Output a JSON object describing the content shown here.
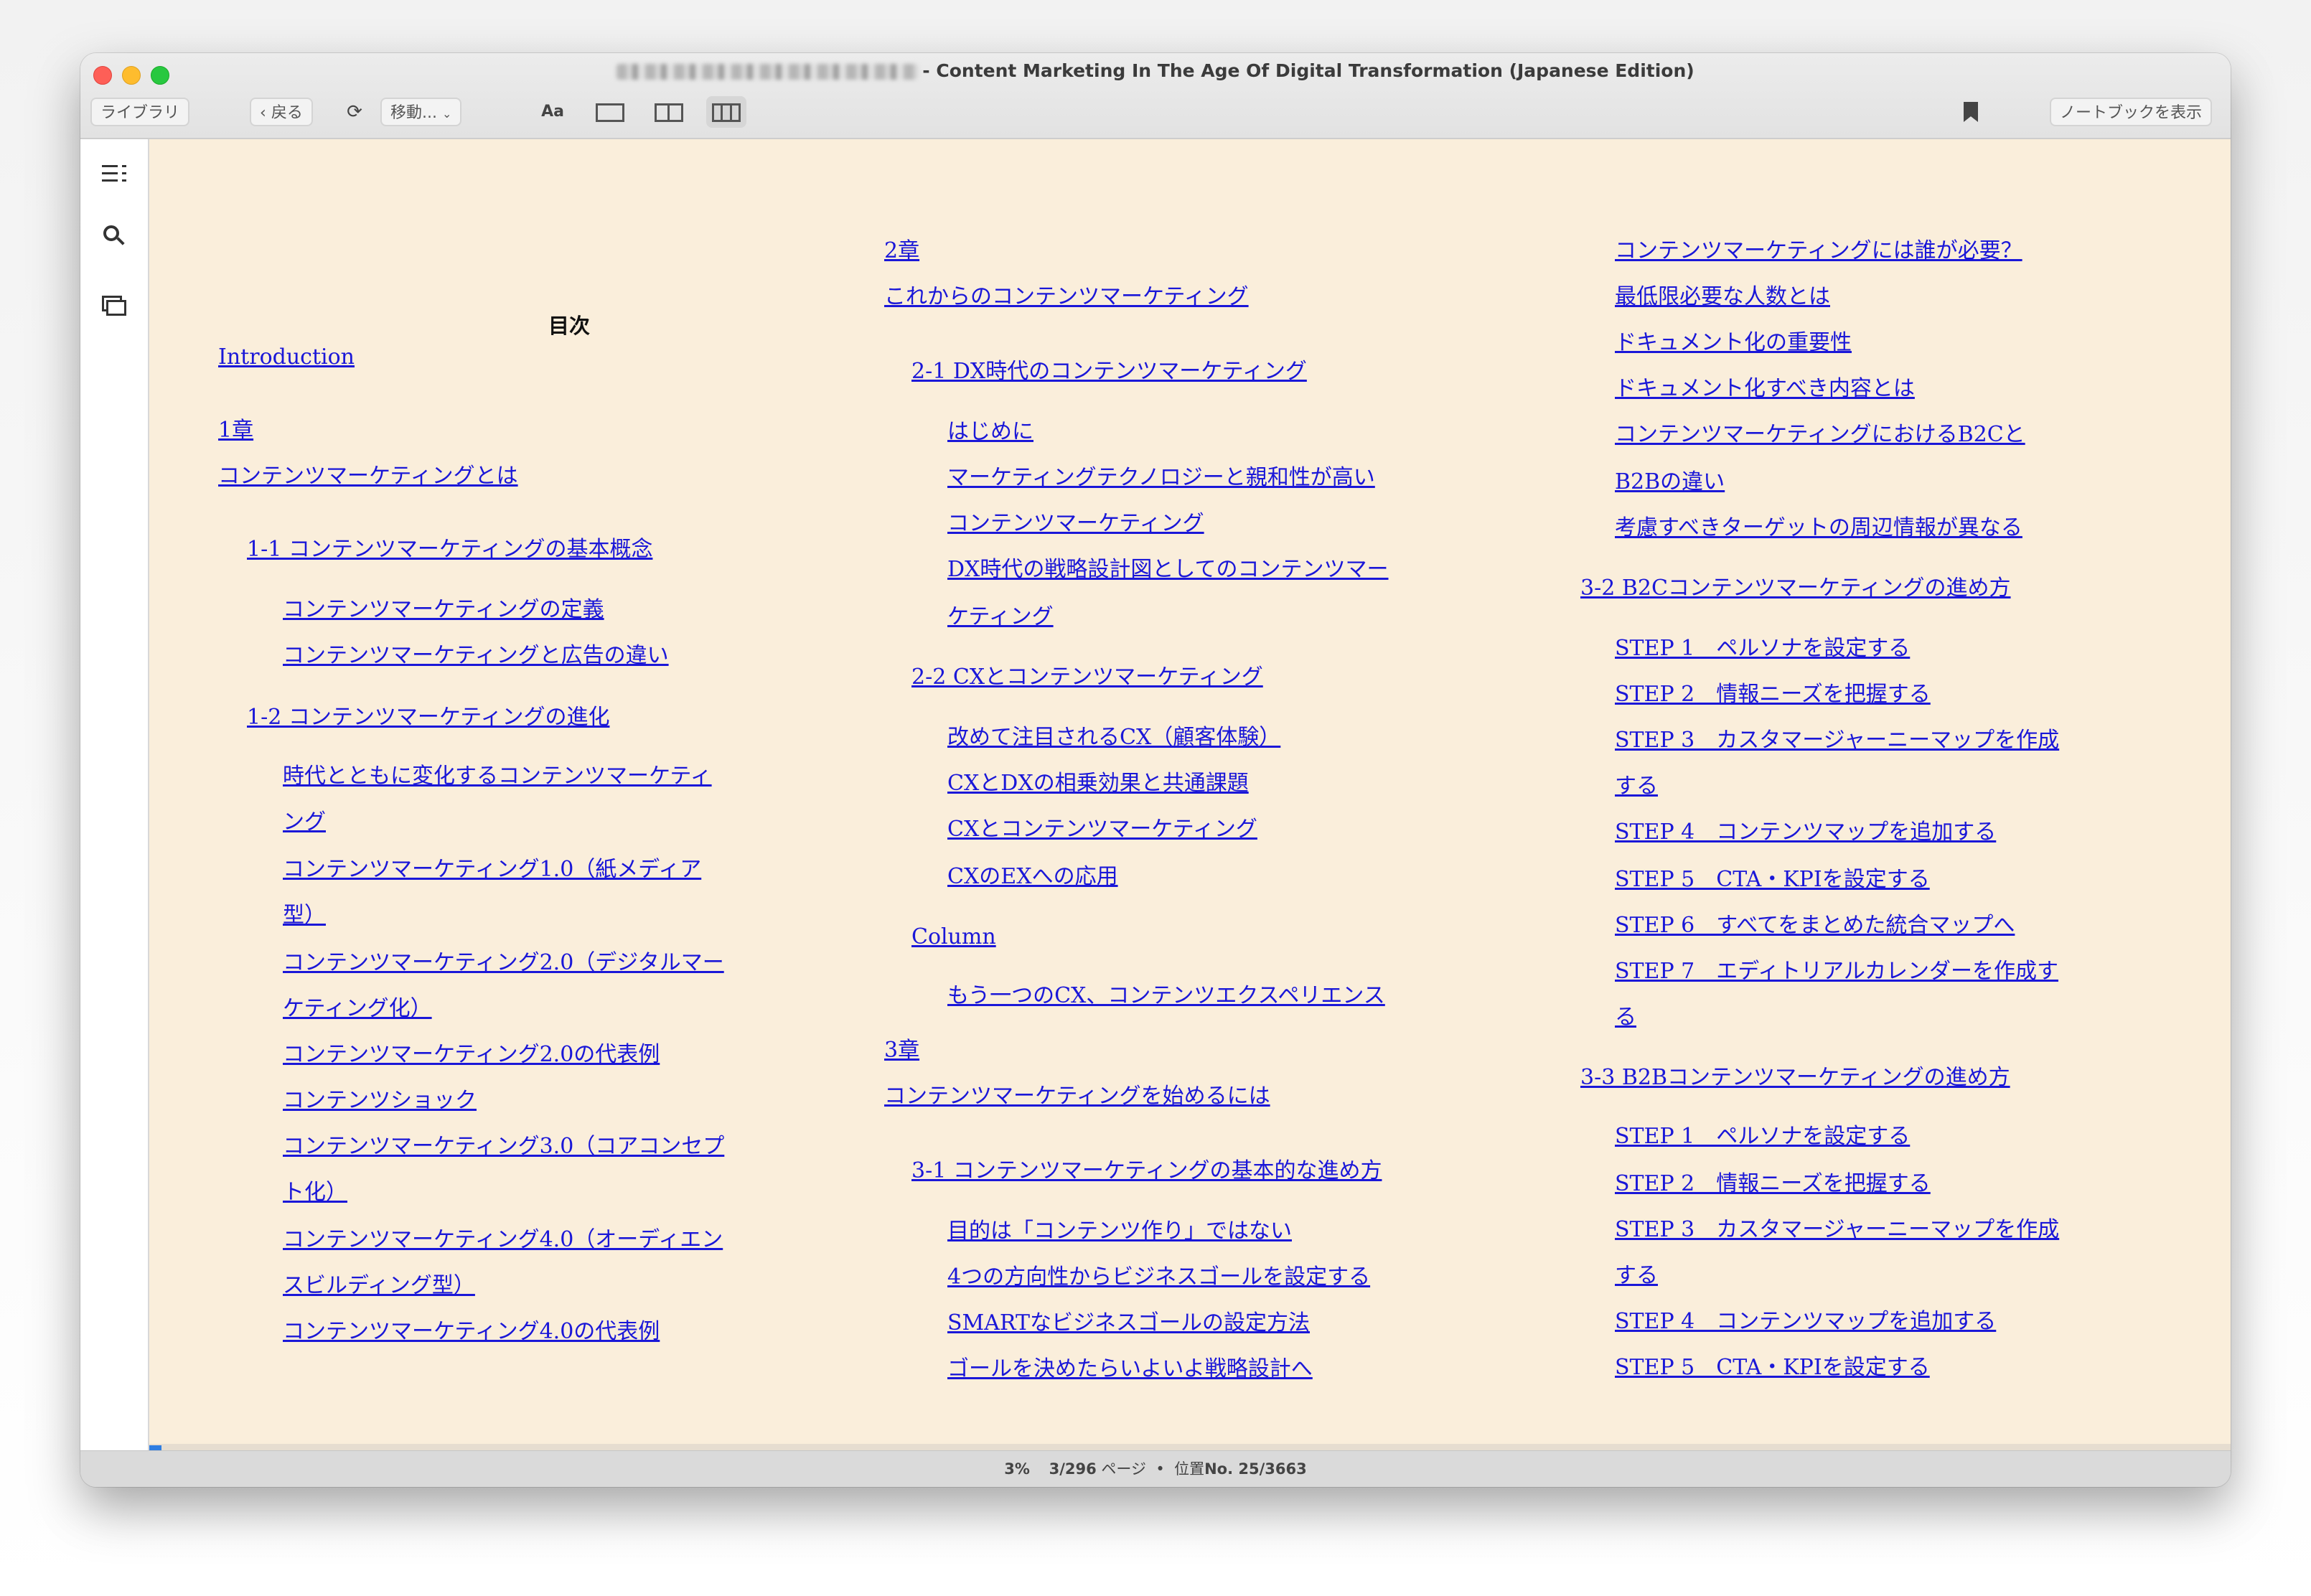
{
  "window": {
    "title": "- Content Marketing In The Age Of Digital Transformation (Japanese Edition)"
  },
  "toolbar": {
    "library": "ライブラリ",
    "back": "戻る",
    "back_icon": "chevron-left-icon",
    "goto": "移動...",
    "font": "Aa",
    "notebook": "ノートブックを表示"
  },
  "toc": {
    "heading": "目次",
    "col1": [
      "Introduction",
      "1章",
      "コンテンツマーケティングとは",
      "1-1 コンテンツマーケティングの基本概念",
      "コンテンツマーケティングの定義",
      "コンテンツマーケティングと広告の違い",
      "1-2 コンテンツマーケティングの進化",
      "時代とともに変化するコンテンツマーケティ",
      "ング",
      "コンテンツマーケティング1.0（紙メディア",
      "型）",
      "コンテンツマーケティング2.0（デジタルマー",
      "ケティング化）",
      "コンテンツマーケティング2.0の代表例",
      "コンテンツショック",
      "コンテンツマーケティング3.0（コアコンセプ",
      "ト化）",
      "コンテンツマーケティング4.0（オーディエン",
      "スビルディング型）",
      "コンテンツマーケティング4.0の代表例"
    ],
    "col2": [
      "2章",
      "これからのコンテンツマーケティング",
      "2-1 DX時代のコンテンツマーケティング",
      "はじめに",
      "マーケティングテクノロジーと親和性が高い",
      "コンテンツマーケティング",
      "DX時代の戦略設計図としてのコンテンツマー",
      "ケティング",
      "2-2 CXとコンテンツマーケティング",
      "改めて注目されるCX（顧客体験）",
      "CXとDXの相乗効果と共通課題",
      "CXとコンテンツマーケティング",
      "CXのEXへの応用",
      "Column",
      "もう一つのCX、コンテンツエクスペリエンス",
      "3章",
      "コンテンツマーケティングを始めるには",
      "3-1 コンテンツマーケティングの基本的な進め方",
      "目的は「コンテンツ作り」ではない",
      "4つの方向性からビジネスゴールを設定する",
      "SMARTなビジネスゴールの設定方法",
      "ゴールを決めたらいよいよ戦略設計へ"
    ],
    "col3": [
      "コンテンツマーケティングには誰が必要？",
      "最低限必要な人数とは",
      "ドキュメント化の重要性",
      "ドキュメント化すべき内容とは",
      "コンテンツマーケティングにおけるB2Cと",
      "B2Bの違い",
      "考慮すべきターゲットの周辺情報が異なる",
      "3-2 B2Cコンテンツマーケティングの進め方",
      "STEP 1　ペルソナを設定する",
      "STEP 2　情報ニーズを把握する",
      "STEP 3　カスタマージャーニーマップを作成",
      "する",
      "STEP 4　コンテンツマップを追加する",
      "STEP 5　CTA・KPIを設定する",
      "STEP 6　すべてをまとめた統合マップへ",
      "STEP 7　エディトリアルカレンダーを作成す",
      "る",
      "3-3 B2Bコンテンツマーケティングの進め方",
      "STEP 1　ペルソナを設定する",
      "STEP 2　情報ニーズを把握する",
      "STEP 3　カスタマージャーニーマップを作成",
      "する",
      "STEP 4　コンテンツマップを追加する",
      "STEP 5　CTA・KPIを設定する"
    ]
  },
  "status": {
    "percent": "3%",
    "page": "3/296",
    "page_unit": "ページ",
    "separator": "•",
    "location_label": "位置",
    "location": "No. 25/3663",
    "progress": 0.03
  }
}
